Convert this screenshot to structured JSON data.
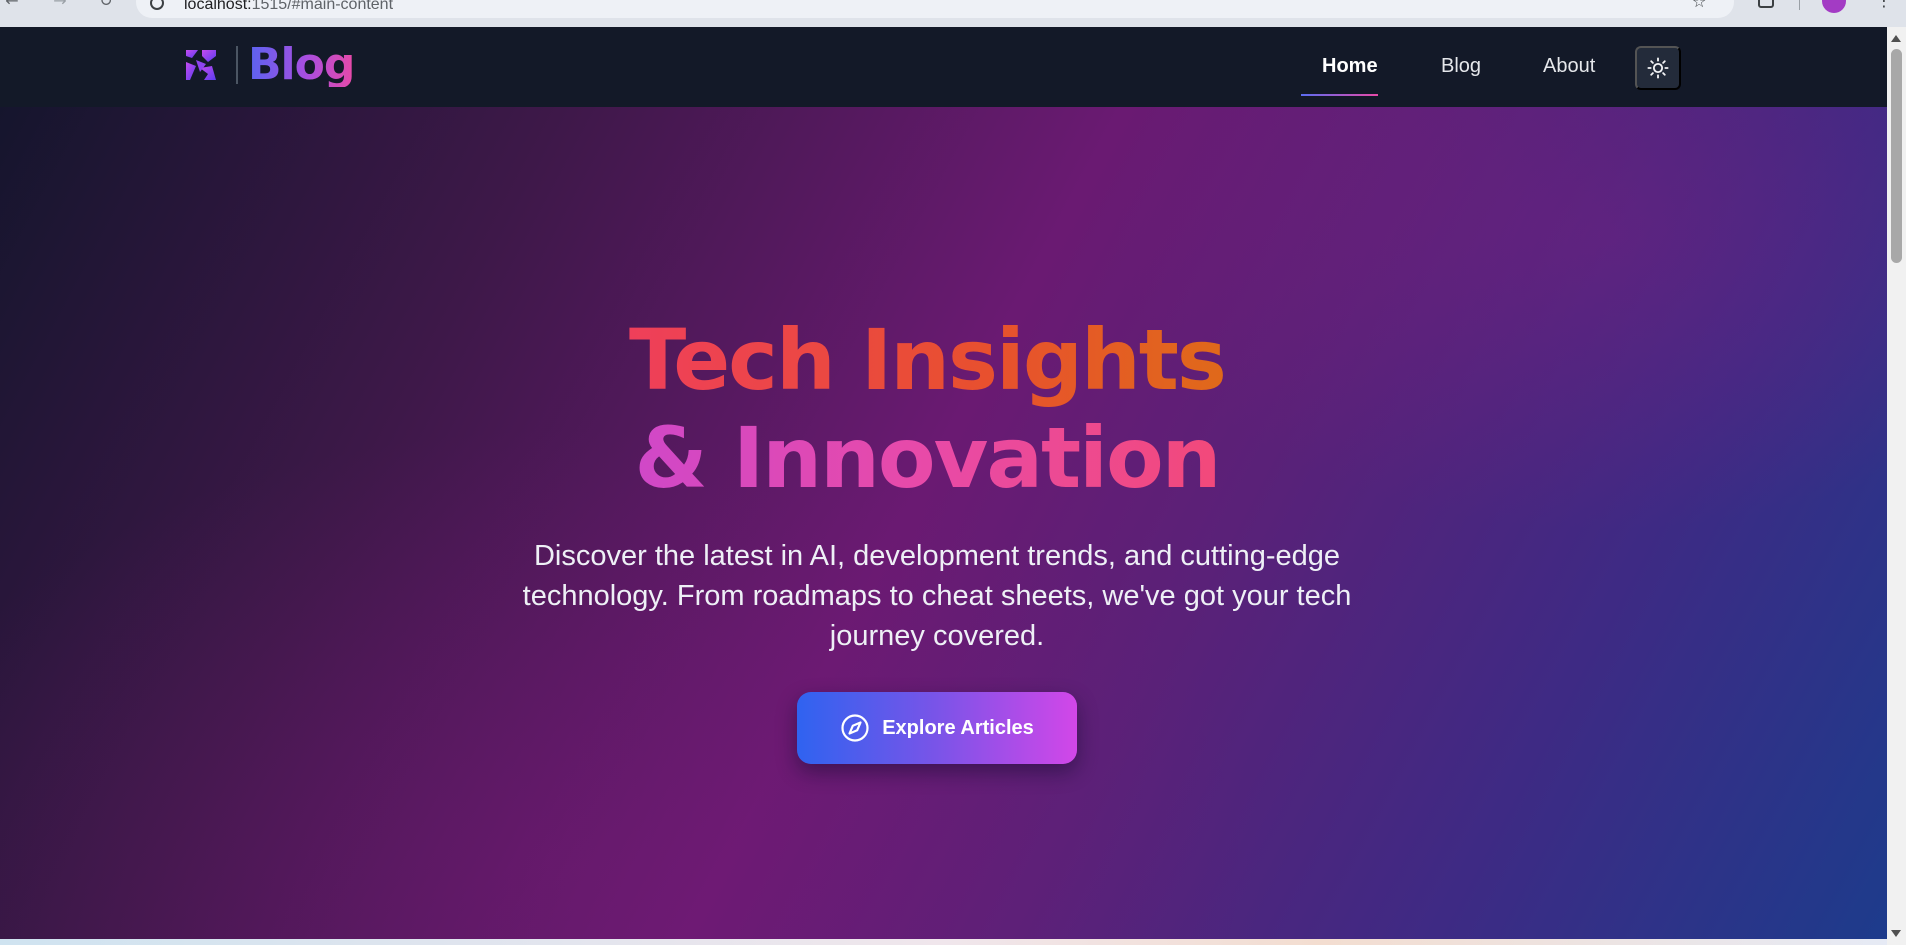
{
  "browser": {
    "url_host": "localhost:",
    "url_rest": "1515/#main-content",
    "back_icon": "arrow-left-icon",
    "forward_icon": "arrow-right-icon",
    "reload_icon": "reload-icon",
    "bookmark_icon": "star-icon",
    "menu_icon": "more-vert-icon"
  },
  "header": {
    "brand_name": "Blog",
    "logo_icon": "logo-mark-icon",
    "nav": [
      {
        "label": "Home",
        "active": true
      },
      {
        "label": "Blog",
        "active": false
      },
      {
        "label": "About",
        "active": false
      }
    ],
    "theme_toggle_icon": "sun-icon"
  },
  "hero": {
    "title_line_1": "Tech Insights",
    "title_line_2": "& Innovation",
    "subtitle_lines": [
      "Discover the latest in AI, development trends, and cutting-edge",
      "technology. From roadmaps to cheat sheets, we've got your tech",
      "journey covered."
    ],
    "cta_label": "Explore Articles",
    "cta_icon": "compass-icon"
  },
  "colors": {
    "header_bg": "#131928",
    "accent_blue": "#2f63f0",
    "accent_pink": "#d247e8",
    "title_orange": "#e8502e",
    "title_pink": "#e84aa8"
  }
}
